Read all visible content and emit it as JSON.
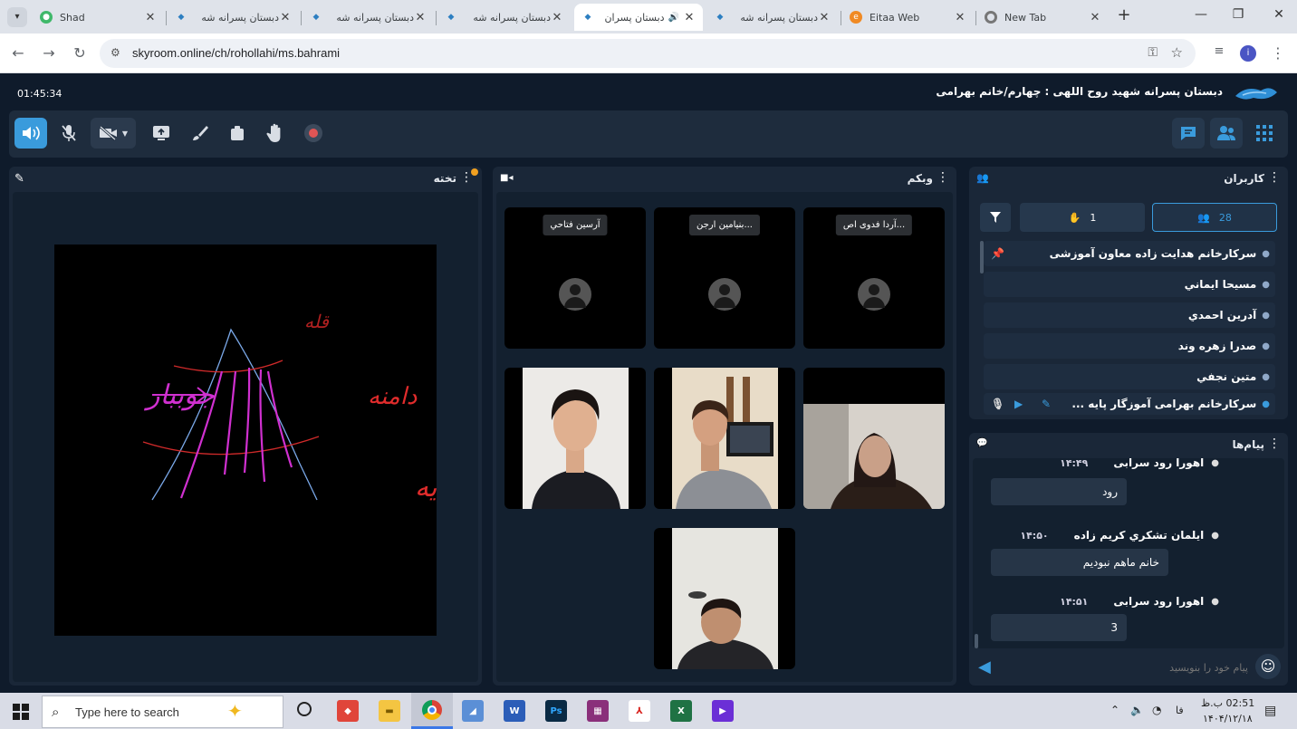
{
  "browser": {
    "tabs": [
      {
        "title": "Shad",
        "active": false
      },
      {
        "title": "دبستان پسرانه شه",
        "active": false
      },
      {
        "title": "دبستان پسرانه شه",
        "active": false
      },
      {
        "title": "دبستان پسرانه شه",
        "active": false
      },
      {
        "title": "دبستان پسران",
        "active": true
      },
      {
        "title": "دبستان پسرانه شه",
        "active": false
      },
      {
        "title": "Eitaa Web",
        "active": false
      },
      {
        "title": "New Tab",
        "active": false
      }
    ],
    "new_tab": "+",
    "url": "skyroom.online/ch/rohollahi/ms.bahrami"
  },
  "app": {
    "timer": "01:45:34",
    "room_title": "دبستان پسرانه شهید روح اللهی : چهارم/خانم بهرامی",
    "colors": {
      "accent": "#3a9bdc",
      "bg": "#0f1b2b",
      "panel": "#1a2738"
    },
    "whiteboard": {
      "title": "تخته",
      "labels": {
        "stream": "جوببار",
        "slope": "دامنه",
        "peak": "قله",
        "foothill": "کوهپایه"
      }
    },
    "webcam": {
      "title": "وبکم",
      "tiles": [
        {
          "name": "آرسين فتاحي"
        },
        {
          "name": "بنيامين ارجن..."
        },
        {
          "name": "آردا فدوی اص..."
        }
      ]
    },
    "users": {
      "title": "کاربران",
      "count": "28",
      "hands": "1",
      "list": [
        "سرکارخانم هدایت زاده معاون آموزشی",
        "مسيحا ايماني",
        "آدرين احمدي",
        "صدرا زهره وند",
        "متين نجفي",
        "سرکارخانم بهرامی آموزگار پایه ..."
      ]
    },
    "messages": {
      "title": "پیام‌ها",
      "items": [
        {
          "author": "اهورا رود سرابی",
          "time": "۱۴:۴۹",
          "text": "رود"
        },
        {
          "author": "ايلمان تشكري كريم زاده",
          "time": "۱۴:۵۰",
          "text": "خانم ماهم نبوديم"
        },
        {
          "author": "اهورا رود سرابی",
          "time": "۱۴:۵۱",
          "text": "3"
        }
      ],
      "input_placeholder": "پیام خود را بنویسید"
    }
  },
  "taskbar": {
    "search_placeholder": "Type here to search",
    "lang": "فا",
    "time": "02:51 ب.ظ",
    "date": "۱۴۰۴/۱۲/۱۸"
  }
}
